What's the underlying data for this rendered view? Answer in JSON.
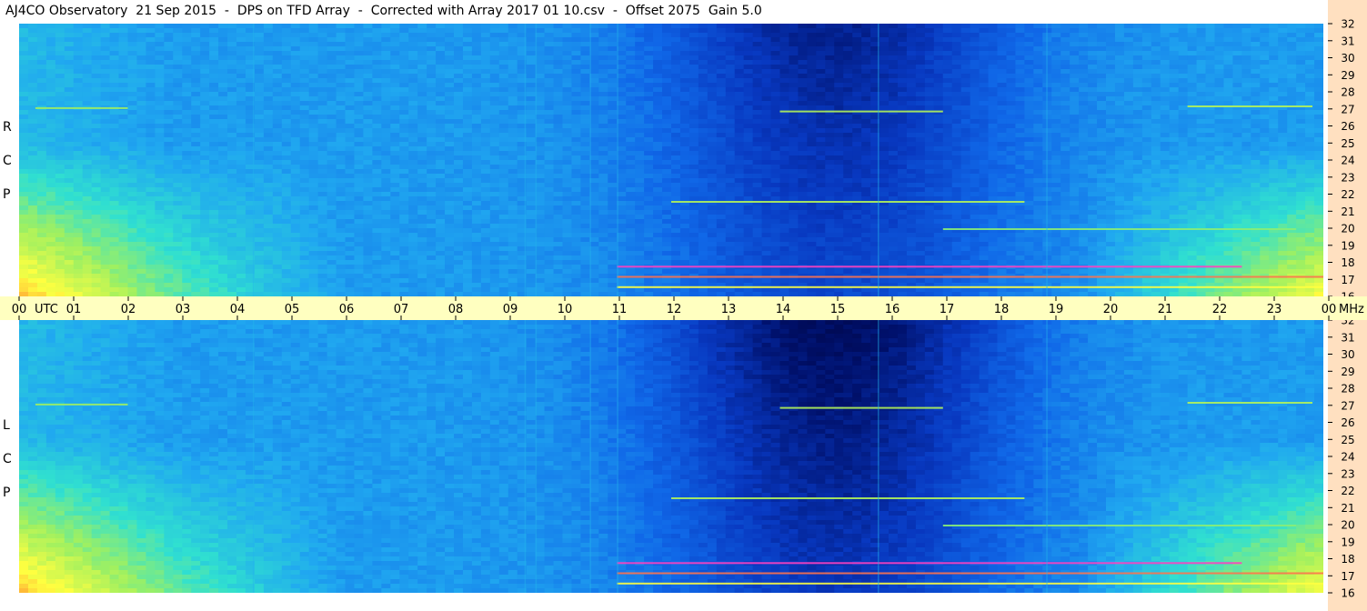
{
  "header": {
    "title": "AJ4CO Observatory  21 Sep 2015  -  DPS on TFD Array  -  Corrected with Array 2017 01 10.csv  -  Offset 2075  Gain 5.0"
  },
  "chart_data": {
    "type": "heatmap",
    "title": "AJ4CO Observatory  21 Sep 2015  -  DPS on TFD Array  -  Corrected with Array 2017 01 10.csv  -  Offset 2075  Gain 5.0",
    "x_axis": {
      "ticks": [
        "00",
        "01",
        "02",
        "03",
        "04",
        "05",
        "06",
        "07",
        "08",
        "09",
        "10",
        "11",
        "12",
        "13",
        "14",
        "15",
        "16",
        "17",
        "18",
        "19",
        "20",
        "21",
        "22",
        "23",
        "00"
      ],
      "unit": "UTC",
      "range": [
        0,
        24
      ]
    },
    "y_axis": {
      "ticks": [
        "32",
        "31",
        "30",
        "29",
        "28",
        "27",
        "26",
        "25",
        "24",
        "23",
        "22",
        "21",
        "20",
        "19",
        "18",
        "17",
        "16"
      ],
      "unit": "MHz",
      "range": [
        16,
        32
      ]
    },
    "panels": [
      {
        "name": "rcp",
        "label": [
          "R",
          "C",
          "P"
        ]
      },
      {
        "name": "lcp",
        "label": [
          "L",
          "C",
          "P"
        ]
      }
    ],
    "colormap": [
      "#000030",
      "#00106a",
      "#0838c0",
      "#1068e8",
      "#20a8f0",
      "#30e0d0",
      "#a0f060",
      "#ffff40",
      "#ff8030",
      "#ff40c0",
      "#ffffff"
    ]
  }
}
